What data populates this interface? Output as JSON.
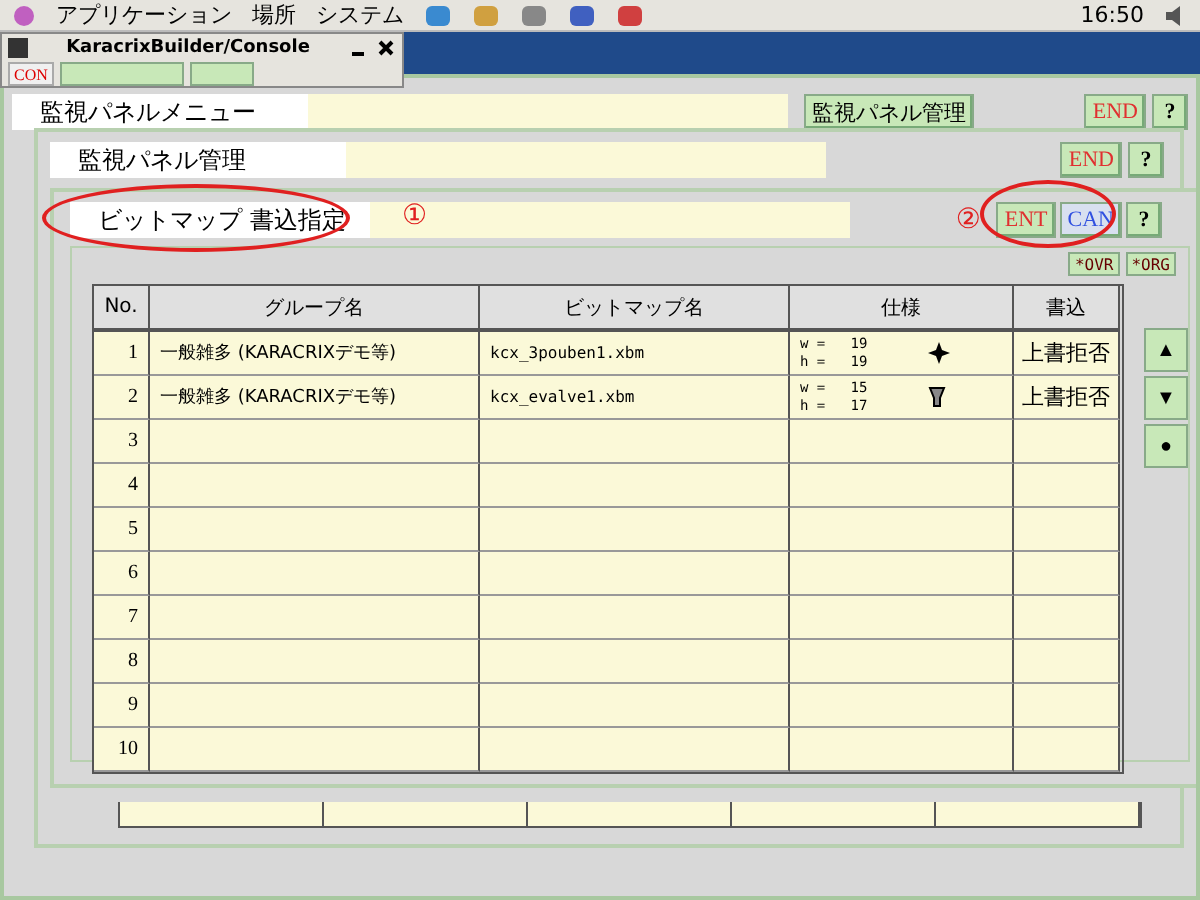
{
  "top_panel": {
    "menus": [
      "アプリケーション",
      "場所",
      "システム"
    ],
    "clock": "16:50"
  },
  "console": {
    "title": "KaracrixBuilder/Console",
    "button": "CON"
  },
  "main_window": {
    "title": "監視パネルメニュー",
    "button": "監視パネル管理",
    "end": "END",
    "help": "?"
  },
  "panel": {
    "title": "監視パネル管理",
    "end": "END",
    "help": "?"
  },
  "dialog": {
    "title": "ビットマップ 書込指定",
    "marker_1": "①",
    "marker_2": "②",
    "buttons": [
      {
        "kind": "ent",
        "label": "ENT"
      },
      {
        "kind": "can",
        "label": "CAN"
      },
      {
        "kind": "help",
        "label": "?"
      }
    ],
    "small_buttons": [
      "*OVR",
      "*ORG"
    ],
    "table": {
      "columns": [
        "No.",
        "グループ名",
        "ビットマップ名",
        "仕様",
        "書込"
      ],
      "rows": [
        {
          "no": "1",
          "group": "一般雑多 (KARACRIXデモ等)",
          "bitmap": "kcx_3pouben1.xbm",
          "w": "w =   19",
          "h": "h =   19",
          "kind": "cross",
          "write": "上書拒否"
        },
        {
          "no": "2",
          "group": "一般雑多 (KARACRIXデモ等)",
          "bitmap": "kcx_evalve1.xbm",
          "w": "w =   15",
          "h": "h =   17",
          "kind": "valve",
          "write": "上書拒否"
        },
        {
          "no": "3"
        },
        {
          "no": "4"
        },
        {
          "no": "5"
        },
        {
          "no": "6"
        },
        {
          "no": "7"
        },
        {
          "no": "8"
        },
        {
          "no": "9"
        },
        {
          "no": "10"
        }
      ]
    },
    "scroll_buttons": [
      "▲",
      "▼",
      "●"
    ]
  }
}
